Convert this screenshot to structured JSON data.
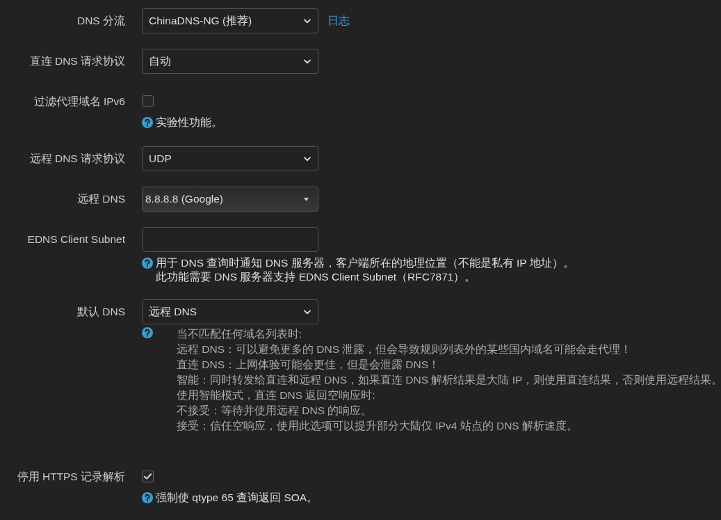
{
  "settings": [
    {
      "kind": "select",
      "label": "DNS 分流",
      "value": "ChinaDNS-NG (推荐)",
      "link": "日志"
    },
    {
      "kind": "select",
      "label": "直连 DNS 请求协议",
      "value": "自动"
    },
    {
      "kind": "checkbox",
      "label": "过滤代理域名 IPv6",
      "checked": false,
      "help_indented": false,
      "help": [
        "实验性功能。"
      ]
    },
    {
      "kind": "select",
      "label": "远程 DNS 请求协议",
      "value": "UDP"
    },
    {
      "kind": "combobox",
      "label": "远程 DNS",
      "value": "8.8.8.8 (Google)"
    },
    {
      "kind": "text",
      "label": "EDNS Client Subnet",
      "help_indented": false,
      "help": [
        "用于 DNS 查询时通知 DNS 服务器，客户端所在的地理位置（不能是私有 IP 地址）。",
        "此功能需要 DNS 服务器支持 EDNS Client Subnet（RFC7871）。"
      ]
    },
    {
      "kind": "select",
      "label": "默认 DNS",
      "value": "远程 DNS",
      "help_indented": true,
      "help": [
        "当不匹配任何域名列表时:",
        "远程 DNS：可以避免更多的 DNS 泄露，但会导致规则列表外的某些国内域名可能会走代理！",
        "直连 DNS：上网体验可能会更佳，但是会泄露 DNS！",
        "智能：同时转发给直连和远程 DNS，如果直连 DNS 解析结果是大陆 IP，则使用直连结果，否则使用远程结果。",
        "使用智能模式，直连 DNS 返回空响应时:",
        "不接受：等待并使用远程 DNS 的响应。",
        "接受：信任空响应，使用此选项可以提升部分大陆仅 IPv4 站点的 DNS 解析速度。"
      ]
    },
    {
      "kind": "checkbox",
      "label": "停用 HTTPS 记录解析",
      "checked": true,
      "help_indented": false,
      "help": [
        "强制使 qtype 65 查询返回 SOA。"
      ]
    }
  ]
}
